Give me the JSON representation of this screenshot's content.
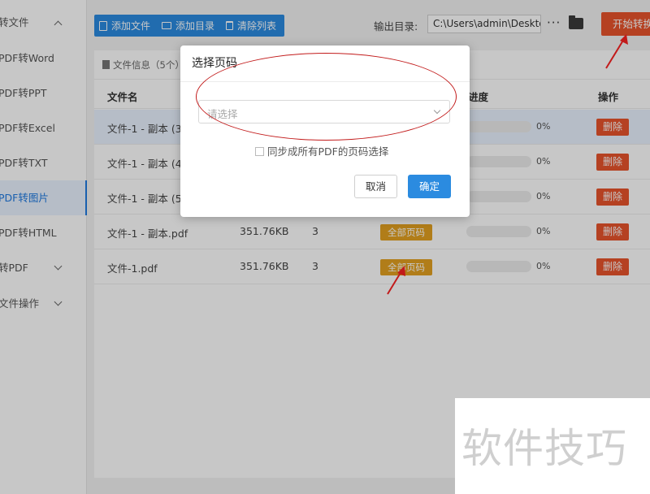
{
  "sidebar": {
    "items": [
      {
        "label": "转文件",
        "chevron": "up"
      },
      {
        "label": "PDF转Word"
      },
      {
        "label": "PDF转PPT"
      },
      {
        "label": "PDF转Excel"
      },
      {
        "label": "PDF转TXT"
      },
      {
        "label": "PDF转图片",
        "active": true
      },
      {
        "label": "PDF转HTML"
      },
      {
        "label": "转PDF",
        "chevron": "down"
      },
      {
        "label": "文件操作",
        "chevron": "down"
      }
    ]
  },
  "toolbar": {
    "add_file": "添加文件",
    "add_dir": "添加目录",
    "clear_list": "清除列表",
    "output_label": "输出目录:",
    "output_path": "C:\\Users\\admin\\Deskto",
    "more": "···",
    "start": "开始转换"
  },
  "info": {
    "text": "文件信息（5个）"
  },
  "table": {
    "headers": {
      "name": "文件名",
      "progress": "进度",
      "action": "操作"
    },
    "rows": [
      {
        "name": "文件-1 - 副本 (3)",
        "size": "",
        "pages": "",
        "page_range": "",
        "percent": "0%",
        "delete": "删除",
        "selected": true
      },
      {
        "name": "文件-1 - 副本 (4)",
        "size": "",
        "pages": "",
        "page_range": "",
        "percent": "0%",
        "delete": "删除"
      },
      {
        "name": "文件-1 - 副本 (5)",
        "size": "",
        "pages": "",
        "page_range": "",
        "percent": "0%",
        "delete": "删除"
      },
      {
        "name": "文件-1 - 副本.pdf",
        "size": "351.76KB",
        "pages": "3",
        "page_range": "全部页码",
        "percent": "0%",
        "delete": "删除"
      },
      {
        "name": "文件-1.pdf",
        "size": "351.76KB",
        "pages": "3",
        "page_range": "全部页码",
        "percent": "0%",
        "delete": "删除"
      }
    ]
  },
  "dialog": {
    "title": "选择页码",
    "placeholder": "请选择",
    "sync_label": "同步成所有PDF的页码选择",
    "cancel": "取消",
    "ok": "确定"
  },
  "watermark": {
    "text": "软件技巧"
  },
  "colors": {
    "accent": "#2b8be0",
    "danger": "#e8542c",
    "badge": "#e3a020",
    "annotation": "#c21a1a"
  }
}
